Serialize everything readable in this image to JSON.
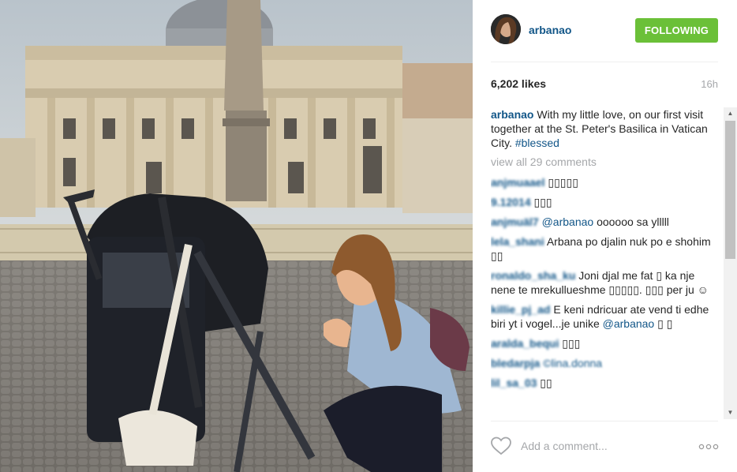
{
  "post": {
    "username": "arbanao",
    "follow_label": "FOLLOWING",
    "likes": "6,202 likes",
    "time": "16h",
    "caption": {
      "user": "arbanao",
      "text": "With my little love, on our first visit together at the St. Peter's Basilica in Vatican City.",
      "hashtag": "#blessed"
    },
    "view_all": "view all 29 comments",
    "comments": [
      {
        "user": "anjmuaael",
        "text": "▯▯▯▯▯"
      },
      {
        "user": "9.12014",
        "text": "▯▯▯"
      },
      {
        "user": "anjmuäl7",
        "mention": "@arbanao",
        "text": "oooooo sa ylllll"
      },
      {
        "user": "lela_shani",
        "text": "Arbana po djalin nuk po e shohim ▯▯"
      },
      {
        "user": "ronaldo_sha_ku",
        "text": "Joni djal me fat ▯ ka nje nene te mrekullueshme ▯▯▯▯▯. ▯▯▯ per ju ☺"
      },
      {
        "user": "killie_pj_ad",
        "text": "E keni ndricuar ate vend ti edhe biri yt i vogel...je unike",
        "mention": "@arbanao",
        "trail": "▯ ▯"
      },
      {
        "user": "aralda_bequi",
        "text": "▯▯▯"
      },
      {
        "user": "bledarpja",
        "text": "©lina.donna"
      },
      {
        "user": "lil_sa_03",
        "text": "▯▯"
      }
    ],
    "add_comment_placeholder": "Add a comment...",
    "more_label": "ooo"
  },
  "icons": {
    "like": "heart-outline-icon",
    "more": "more-options-icon"
  },
  "colors": {
    "link_blue": "#125688",
    "follow_green": "#6bc038",
    "muted_gray": "#a5a7aa"
  }
}
